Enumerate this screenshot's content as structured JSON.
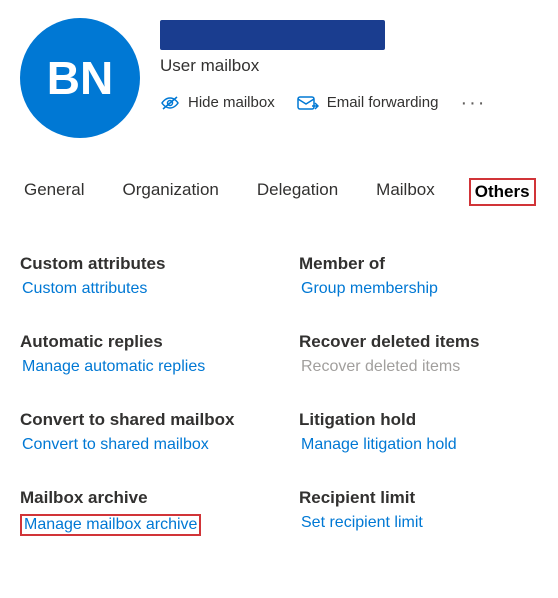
{
  "colors": {
    "accent": "#0078d4",
    "highlight": "#d13438"
  },
  "header": {
    "avatar_initials": "BN",
    "subtitle": "User mailbox",
    "actions": {
      "hide_mailbox": "Hide mailbox",
      "email_forwarding": "Email forwarding"
    }
  },
  "tabs": {
    "general": "General",
    "organization": "Organization",
    "delegation": "Delegation",
    "mailbox": "Mailbox",
    "others": "Others",
    "active": "others"
  },
  "sections": {
    "custom_attributes": {
      "title": "Custom attributes",
      "link": "Custom attributes"
    },
    "member_of": {
      "title": "Member of",
      "link": "Group membership"
    },
    "automatic_replies": {
      "title": "Automatic replies",
      "link": "Manage automatic replies"
    },
    "recover_deleted": {
      "title": "Recover deleted items",
      "link": "Recover deleted items"
    },
    "convert_shared": {
      "title": "Convert to shared mailbox",
      "link": "Convert to shared mailbox"
    },
    "litigation_hold": {
      "title": "Litigation hold",
      "link": "Manage litigation hold"
    },
    "mailbox_archive": {
      "title": "Mailbox archive",
      "link": "Manage mailbox archive"
    },
    "recipient_limit": {
      "title": "Recipient limit",
      "link": "Set recipient limit"
    }
  }
}
